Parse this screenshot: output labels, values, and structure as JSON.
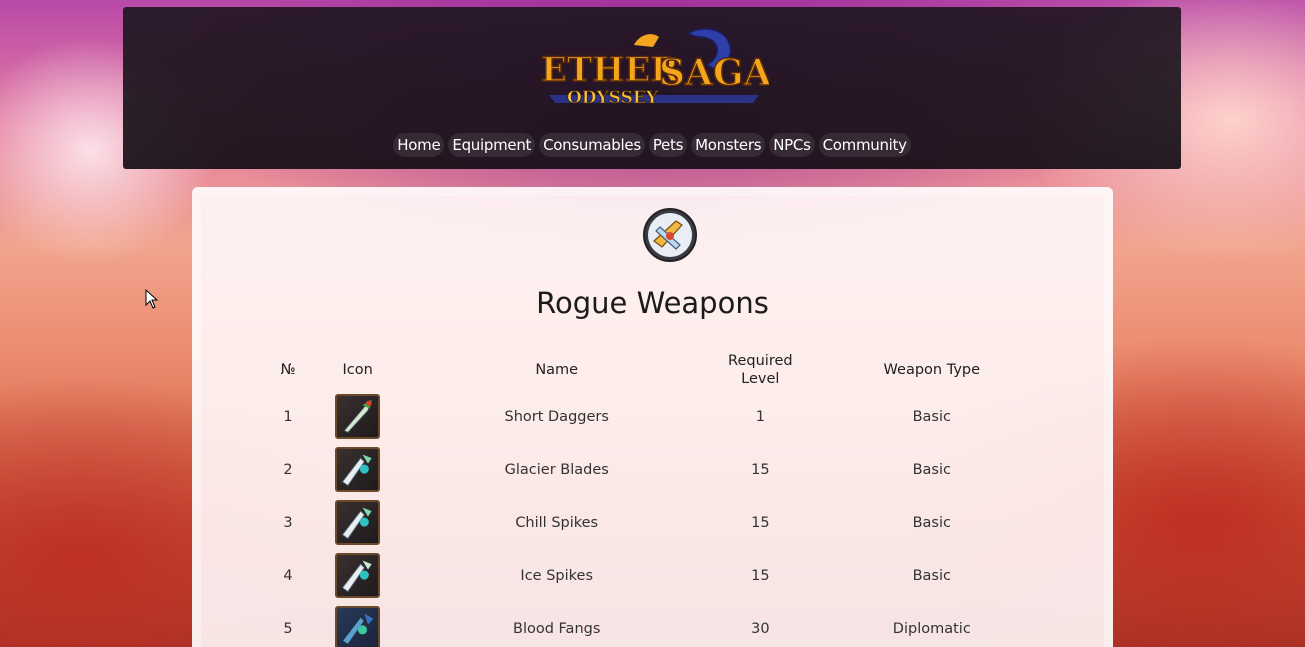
{
  "header": {
    "logo_line1a": "ETHER",
    "logo_line1b": "SAGA",
    "logo_line2": "ODYSSEY",
    "nav": [
      "Home",
      "Equipment",
      "Consumables",
      "Pets",
      "Monsters",
      "NPCs",
      "Community"
    ]
  },
  "page": {
    "title": "Rogue Weapons",
    "category_icon": "rogue-daggers-icon"
  },
  "table": {
    "headers": [
      "№",
      "Icon",
      "Name",
      "Required Level",
      "Weapon Type"
    ],
    "rows": [
      {
        "no": "1",
        "icon": "short-daggers-icon",
        "name": "Short Daggers",
        "level": "1",
        "type": "Basic"
      },
      {
        "no": "2",
        "icon": "glacier-blades-icon",
        "name": "Glacier Blades",
        "level": "15",
        "type": "Basic"
      },
      {
        "no": "3",
        "icon": "chill-spikes-icon",
        "name": "Chill Spikes",
        "level": "15",
        "type": "Basic"
      },
      {
        "no": "4",
        "icon": "ice-spikes-icon",
        "name": "Ice Spikes",
        "level": "15",
        "type": "Basic"
      },
      {
        "no": "5",
        "icon": "blood-fangs-icon",
        "name": "Blood Fangs",
        "level": "30",
        "type": "Diplomatic"
      }
    ]
  },
  "colors": {
    "header_bg": "#1a1419",
    "panel_bg": "#fff8fa",
    "logo_gold": "#f2a51d",
    "logo_blue": "#2a3aa0"
  }
}
